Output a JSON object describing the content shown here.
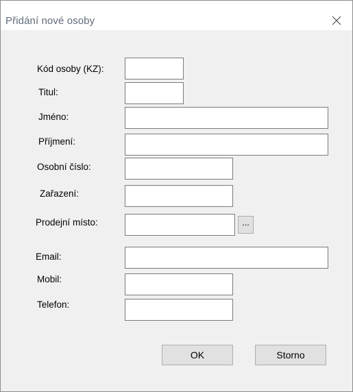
{
  "window": {
    "title": "Přidání nové osoby"
  },
  "form": {
    "labels": {
      "kod_osoby": "Kód osoby (KZ):",
      "titul": "Titul:",
      "jmeno": "Jméno:",
      "prijmeni": "Příjmení:",
      "osobni_cislo": "Osobní číslo:",
      "zarazeni": "Zařazení:",
      "prodejni_misto": "Prodejní místo:",
      "email": "Email:",
      "mobil": "Mobil:",
      "telefon": "Telefon:"
    },
    "values": {
      "kod_osoby": "",
      "titul": "",
      "jmeno": "",
      "prijmeni": "",
      "osobni_cislo": "",
      "zarazeni": "",
      "prodejni_misto": "",
      "email": "",
      "mobil": "",
      "telefon": ""
    },
    "browse_label": "..."
  },
  "buttons": {
    "ok_label": "OK",
    "cancel_label": "Storno"
  }
}
